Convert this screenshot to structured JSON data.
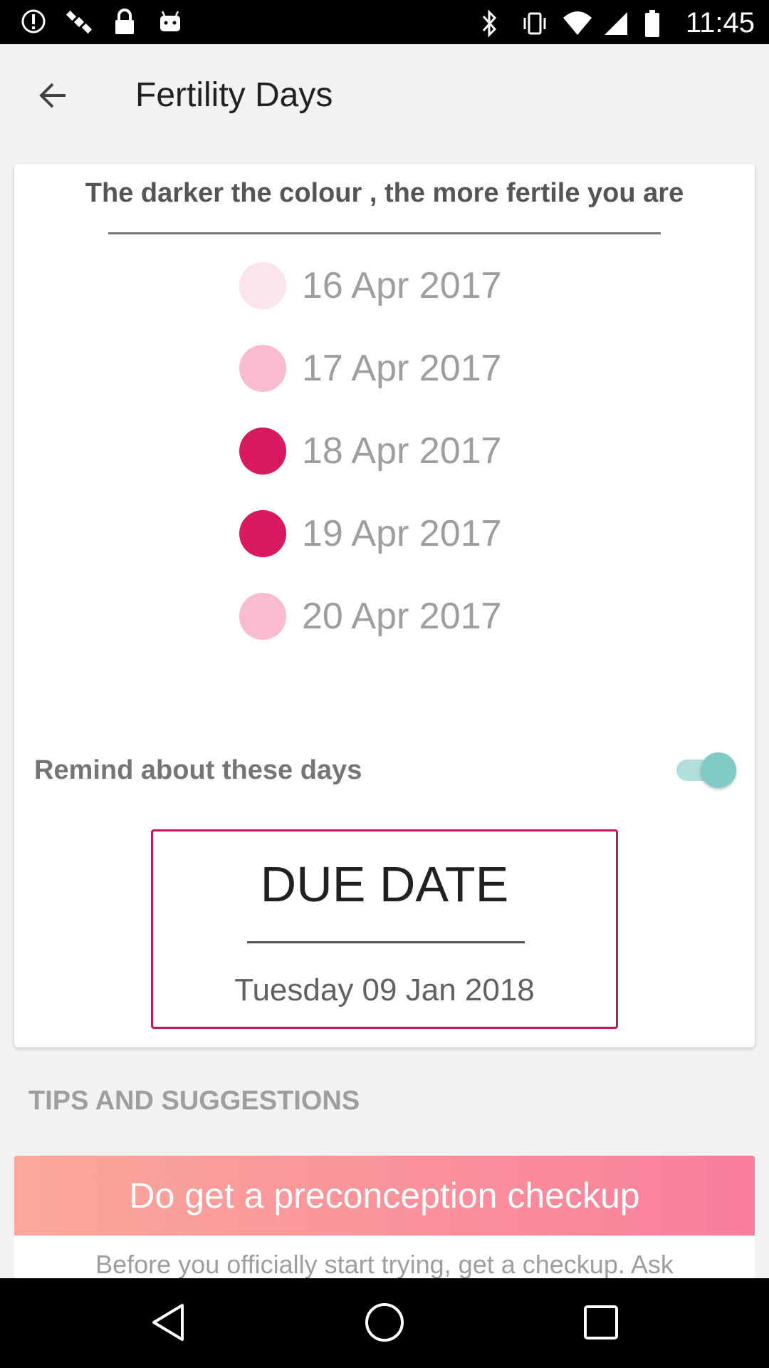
{
  "status_bar": {
    "time": "11:45",
    "left_icons": [
      "alert-icon",
      "satellite-icon",
      "lock-icon",
      "android-icon"
    ],
    "right_icons": [
      "bluetooth-icon",
      "vibrate-icon",
      "wifi-icon",
      "signal-icon",
      "battery-icon"
    ]
  },
  "app_bar": {
    "title": "Fertility Days",
    "back_icon": "arrow-back-icon"
  },
  "card": {
    "heading": "The darker the colour , the more fertile you are",
    "days": [
      {
        "label": "16 Apr 2017",
        "color": "#fbe4ea"
      },
      {
        "label": "17 Apr 2017",
        "color": "#f8bbd0"
      },
      {
        "label": "18 Apr 2017",
        "color": "#d81b60"
      },
      {
        "label": "19 Apr 2017",
        "color": "#d81b60"
      },
      {
        "label": "20 Apr 2017",
        "color": "#f8bbd0"
      }
    ],
    "remind_label": "Remind about these days",
    "remind_enabled": true,
    "due": {
      "title": "DUE DATE",
      "date": "Tuesday 09 Jan 2018"
    }
  },
  "tips": {
    "heading": "TIPS AND SUGGESTIONS",
    "banner": "Do get a preconception checkup",
    "body": "Before you officially start trying, get a checkup. Ask"
  },
  "colors": {
    "accent": "#c2185b",
    "toggle": "#80cbc4",
    "banner_start": "#fba89a",
    "banner_end": "#f97e9c"
  },
  "nav_bar": {
    "icons": [
      "back-triangle-icon",
      "home-circle-icon",
      "recents-square-icon"
    ]
  }
}
